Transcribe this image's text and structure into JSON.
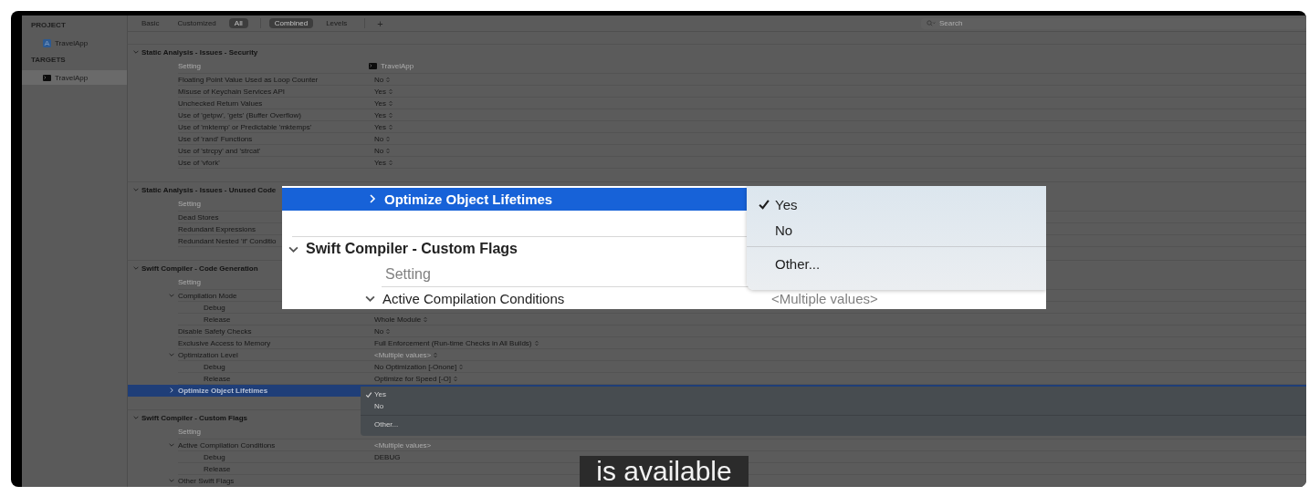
{
  "sidebar": {
    "sections": [
      {
        "title": "PROJECT",
        "items": [
          {
            "label": "TravelApp",
            "kind": "project",
            "selected": false
          }
        ]
      },
      {
        "title": "TARGETS",
        "items": [
          {
            "label": "TravelApp",
            "kind": "target",
            "selected": true
          }
        ]
      }
    ]
  },
  "toolbar": {
    "filter_tabs": [
      {
        "label": "Basic",
        "selected": false
      },
      {
        "label": "Customized",
        "selected": false
      },
      {
        "label": "All",
        "selected": true
      }
    ],
    "view_tabs": [
      {
        "label": "Combined",
        "selected": true
      },
      {
        "label": "Levels",
        "selected": false
      }
    ],
    "add_button": "+",
    "search": {
      "placeholder": "Search"
    }
  },
  "sections": [
    {
      "title": "Static Analysis - Issues - Security",
      "expanded": true,
      "header": {
        "setting": "Setting",
        "target": "TravelApp"
      },
      "rows": [
        {
          "label": "Floating Point Value Used as Loop Counter",
          "value": "No",
          "popup": true
        },
        {
          "label": "Misuse of Keychain Services API",
          "value": "Yes",
          "popup": true
        },
        {
          "label": "Unchecked Return Values",
          "value": "Yes",
          "popup": true
        },
        {
          "label": "Use of 'getpw', 'gets' (Buffer Overflow)",
          "value": "Yes",
          "popup": true
        },
        {
          "label": "Use of 'mktemp' or Predictable 'mktemps'",
          "value": "Yes",
          "popup": true
        },
        {
          "label": "Use of 'rand' Functions",
          "value": "No",
          "popup": true
        },
        {
          "label": "Use of 'strcpy' and 'strcat'",
          "value": "No",
          "popup": true
        },
        {
          "label": "Use of 'vfork'",
          "value": "Yes",
          "popup": true
        }
      ]
    },
    {
      "title": "Static Analysis - Issues - Unused Code",
      "expanded": true,
      "header": {
        "setting": "Setting"
      },
      "rows": [
        {
          "label": "Dead Stores"
        },
        {
          "label": "Redundant Expressions"
        },
        {
          "label": "Redundant Nested 'if' Conditio"
        }
      ]
    },
    {
      "title": "Swift Compiler - Code Generation",
      "expanded": true,
      "header": {
        "setting": "Setting"
      },
      "rows": [
        {
          "label": "Compilation Mode",
          "expanded": true,
          "children": [
            {
              "label": "Debug"
            },
            {
              "label": "Release",
              "value": "Whole Module",
              "popup": true
            }
          ]
        },
        {
          "label": "Disable Safety Checks",
          "value": "No",
          "popup": true
        },
        {
          "label": "Exclusive Access to Memory",
          "value": "Full Enforcement (Run-time Checks in All Builds)",
          "popup": true
        },
        {
          "label": "Optimization Level",
          "expanded": true,
          "value": "<Multiple values>",
          "dimmed": true,
          "popup": true,
          "children": [
            {
              "label": "Debug",
              "value": "No Optimization [-Onone]",
              "popup": true
            },
            {
              "label": "Release",
              "value": "Optimize for Speed [-O]",
              "popup": true
            }
          ]
        },
        {
          "label": "Optimize Object Lifetimes",
          "expanded": false,
          "selected": true
        }
      ]
    },
    {
      "title": "Swift Compiler - Custom Flags",
      "expanded": true,
      "header": {
        "setting": "Setting"
      },
      "rows": [
        {
          "label": "Active Compilation Conditions",
          "expanded": true,
          "value": "<Multiple values>",
          "dimmed": true,
          "popup": false,
          "children": [
            {
              "label": "Debug",
              "value": "DEBUG",
              "popup": false
            },
            {
              "label": "Release"
            }
          ]
        },
        {
          "label": "Other Swift Flags",
          "expanded": true
        }
      ]
    }
  ],
  "popup_menu": [
    {
      "label": "Yes",
      "kind": "option",
      "checked": true
    },
    {
      "label": "No",
      "kind": "option",
      "checked": false
    },
    {
      "label": "Other...",
      "kind": "other"
    }
  ],
  "zoom_inset": {
    "selected_row": {
      "label": "Optimize Object Lifetimes",
      "expanded": false,
      "selected": true
    },
    "section": {
      "title": "Swift Compiler - Custom Flags",
      "expanded": true,
      "header": "Setting",
      "rows": [
        {
          "label": "Active Compilation Conditions",
          "expanded": true,
          "value": "<Multiple values>",
          "dimmed": true
        }
      ]
    },
    "menu": [
      {
        "label": "Yes",
        "kind": "option",
        "checked": true
      },
      {
        "label": "No",
        "kind": "option",
        "checked": false
      },
      {
        "label": "Other...",
        "kind": "other"
      }
    ]
  },
  "caption": "is available"
}
